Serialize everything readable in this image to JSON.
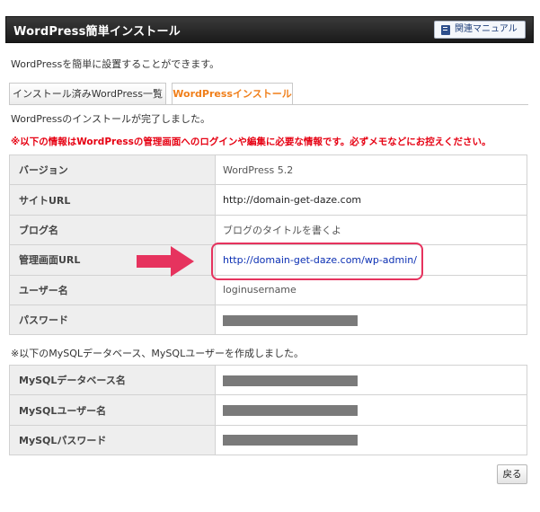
{
  "header": {
    "title": "WordPress簡単インストール",
    "manual_button": "関連マニュアル"
  },
  "intro_text": "WordPressを簡単に設置することができます。",
  "tabs": [
    {
      "label": "インストール済みWordPress一覧",
      "active": false
    },
    {
      "label": "WordPressインストール",
      "active": true
    }
  ],
  "status_message": "WordPressのインストールが完了しました。",
  "warning_message": "※以下の情報はWordPressの管理画面へのログインや編集に必要な情報です。必ずメモなどにお控えください。",
  "install_info": {
    "rows": [
      {
        "label": "バージョン",
        "value": "WordPress 5.2"
      },
      {
        "label": "サイトURL",
        "value": "http://domain-get-daze.com"
      },
      {
        "label": "ブログ名",
        "value": "ブログのタイトルを書くよ"
      },
      {
        "label": "管理画面URL",
        "value": "http://domain-get-daze.com/wp-admin/"
      },
      {
        "label": "ユーザー名",
        "value": "loginusername"
      },
      {
        "label": "パスワード",
        "value": ""
      }
    ]
  },
  "mysql_note": "※以下のMySQLデータベース、MySQLユーザーを作成しました。",
  "mysql_info": {
    "rows": [
      {
        "label": "MySQLデータベース名",
        "value": ""
      },
      {
        "label": "MySQLユーザー名",
        "value": ""
      },
      {
        "label": "MySQLパスワード",
        "value": ""
      }
    ]
  },
  "back_button": "戻る",
  "colors": {
    "warning": "#e60012",
    "active_tab": "#f07f1a",
    "highlight": "#e6335e",
    "link": "#0b2fb3"
  },
  "icons": {
    "manual": "book-icon",
    "annotation": "arrow-right-icon"
  }
}
